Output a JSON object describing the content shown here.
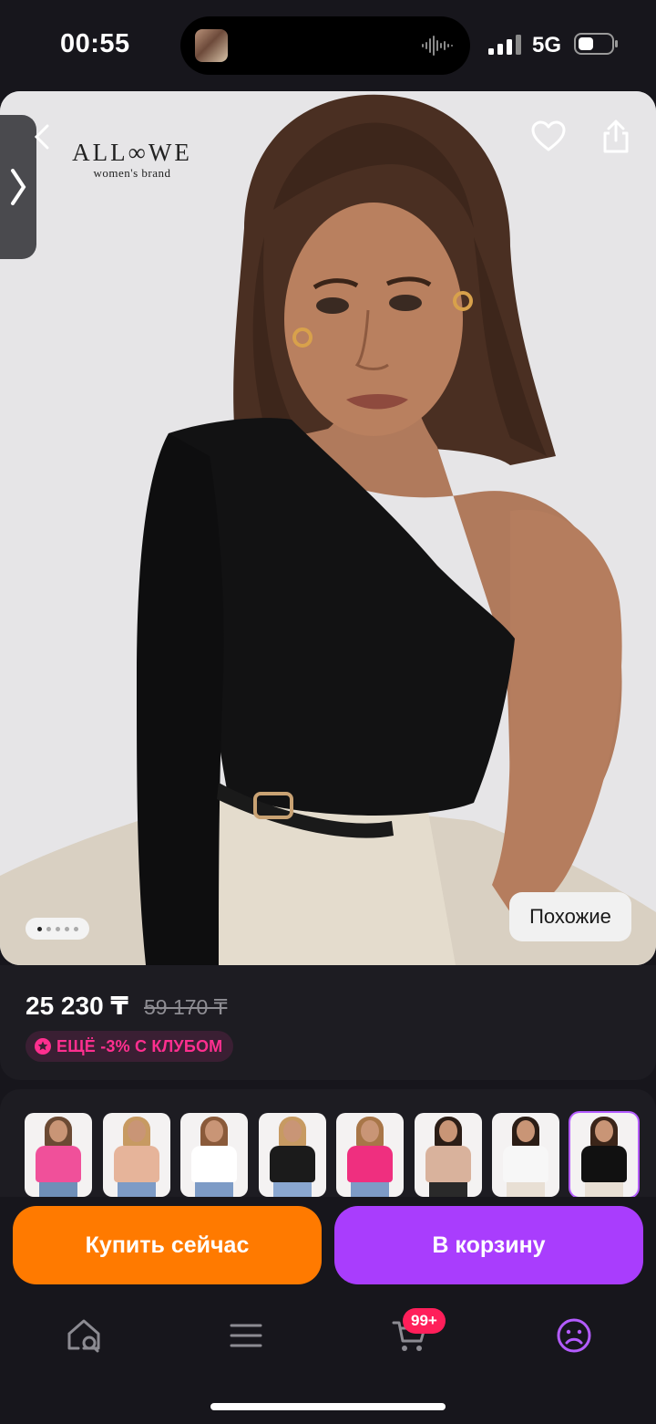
{
  "status_bar": {
    "time": "00:55",
    "network": "5G"
  },
  "hero": {
    "brand_name": "ALL∞WE",
    "brand_sub": "women's brand",
    "similar_label": "Похожие",
    "image_count": 5,
    "active_image": 1
  },
  "price": {
    "current": "25 230 ₸",
    "old": "59 170 ₸",
    "club_label": "ЕЩЁ -3% С КЛУБОМ"
  },
  "variants": [
    {
      "top_color": "#f0509a",
      "bottom_color": "#6f8fb8",
      "hair": "#6b4a34"
    },
    {
      "top_color": "#e6b49a",
      "bottom_color": "#7d9bc6",
      "hair": "#c79a62"
    },
    {
      "top_color": "#ffffff",
      "bottom_color": "#7d9bc6",
      "hair": "#8a5a3a"
    },
    {
      "top_color": "#1b1b1b",
      "bottom_color": "#8aa7d0",
      "hair": "#c79a62"
    },
    {
      "top_color": "#ef2f7f",
      "bottom_color": "#7d9bc6",
      "hair": "#a87648"
    },
    {
      "top_color": "#d9b29c",
      "bottom_color": "#2a2a2a",
      "hair": "#2b1d16"
    },
    {
      "top_color": "#f7f7f7",
      "bottom_color": "#e8dfd4",
      "hair": "#2b1d16"
    },
    {
      "top_color": "#111111",
      "bottom_color": "#e8dfd4",
      "hair": "#3b2519"
    }
  ],
  "selected_variant": 7,
  "actions": {
    "buy_now": "Купить сейчас",
    "add_to_cart": "В корзину"
  },
  "tabbar": {
    "cart_badge": "99+",
    "icons": [
      "search-home-icon",
      "catalog-icon",
      "cart-icon",
      "profile-icon"
    ]
  },
  "colors": {
    "background": "#17161c",
    "buy_button": "#ff7a00",
    "cart_button": "#a93dfd",
    "club_text": "#ff2f8f",
    "badge": "#ff1f5a",
    "active_tab": "#b45cff"
  }
}
